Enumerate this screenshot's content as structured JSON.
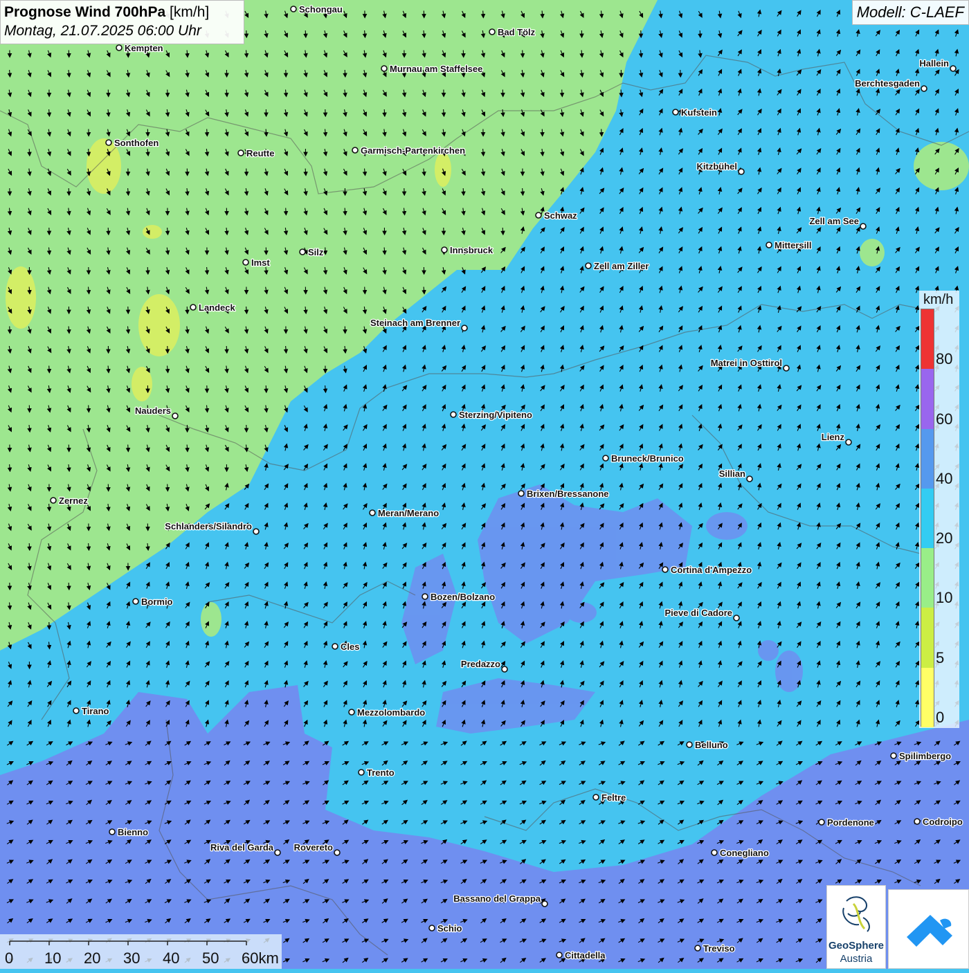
{
  "header": {
    "title_bold": "Prognose Wind 700hPa",
    "title_unit": "[km/h]",
    "datetime": "Montag, 21.07.2025 06:00 Uhr"
  },
  "model": "Modell: C-LAEF",
  "legend": {
    "unit": "km/h",
    "labels": [
      "0",
      "5",
      "10",
      "20",
      "40",
      "60",
      "80"
    ],
    "colors": [
      "#ffff66",
      "#ccee44",
      "#99ee88",
      "#33ccf2",
      "#5599ee",
      "#9966ee",
      "#ee3333"
    ]
  },
  "scalebar": {
    "labels": [
      "0",
      "10",
      "20",
      "30",
      "40",
      "50",
      "60km"
    ]
  },
  "logos": {
    "geosphere_name": "GeoSphere",
    "geosphere_country": "Austria"
  },
  "cities": [
    {
      "name": "Schongau"
    },
    {
      "name": "Bad Tölz"
    },
    {
      "name": "Kempten"
    },
    {
      "name": "Murnau am Staffelsee"
    },
    {
      "name": "Hallein"
    },
    {
      "name": "Berchtesgaden"
    },
    {
      "name": "Kufstein"
    },
    {
      "name": "Sonthofen"
    },
    {
      "name": "Reutte"
    },
    {
      "name": "Garmisch-Partenkirchen"
    },
    {
      "name": "Kitzbühel"
    },
    {
      "name": "Schwaz"
    },
    {
      "name": "Zell am See"
    },
    {
      "name": "Mittersill"
    },
    {
      "name": "Innsbruck"
    },
    {
      "name": "Silz"
    },
    {
      "name": "Imst"
    },
    {
      "name": "Zell am Ziller"
    },
    {
      "name": "Landeck"
    },
    {
      "name": "Steinach am Brenner"
    },
    {
      "name": "Matrei in Osttirol"
    },
    {
      "name": "Nauders"
    },
    {
      "name": "Sterzing/Vipiteno"
    },
    {
      "name": "Lienz"
    },
    {
      "name": "Bruneck/Brunico"
    },
    {
      "name": "Sillian"
    },
    {
      "name": "Brixen/Bressanone"
    },
    {
      "name": "Zernez"
    },
    {
      "name": "Meran/Merano"
    },
    {
      "name": "Schlanders/Silandro"
    },
    {
      "name": "Cortina d'Ampezzo"
    },
    {
      "name": "Bozen/Bolzano"
    },
    {
      "name": "Bormio"
    },
    {
      "name": "Pieve di Cadore"
    },
    {
      "name": "Cles"
    },
    {
      "name": "Predazzo"
    },
    {
      "name": "Tirano"
    },
    {
      "name": "Mezzolombardo"
    },
    {
      "name": "Belluno"
    },
    {
      "name": "Spilimbergo"
    },
    {
      "name": "Trento"
    },
    {
      "name": "Feltre"
    },
    {
      "name": "Pordenone"
    },
    {
      "name": "Codroipo"
    },
    {
      "name": "Bienno"
    },
    {
      "name": "Riva del Garda"
    },
    {
      "name": "Rovereto"
    },
    {
      "name": "Conegliano"
    },
    {
      "name": "Bassano del Grappa"
    },
    {
      "name": "Schio"
    },
    {
      "name": "Treviso"
    },
    {
      "name": "Cittadella"
    }
  ]
}
